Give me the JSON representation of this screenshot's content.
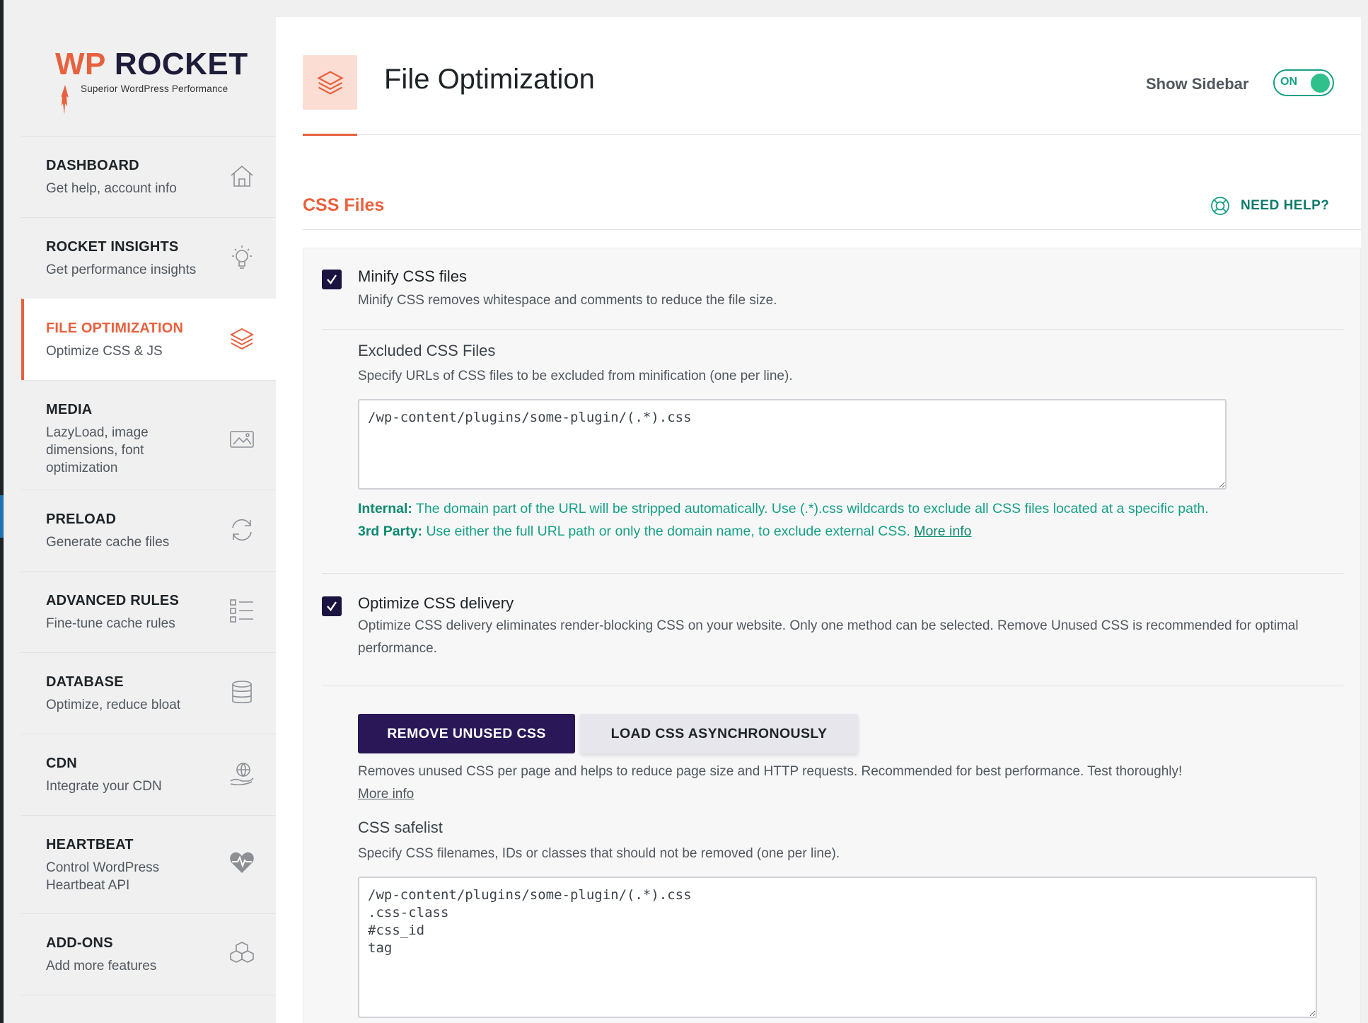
{
  "brand": {
    "logo_wp": "WP",
    "logo_rocket": " ROCKET",
    "tagline": "Superior WordPress Performance",
    "accent_color": "#e8613e",
    "dark_color": "#2a1758",
    "green_color": "#16a085"
  },
  "sidebar": {
    "items": [
      {
        "title": "DASHBOARD",
        "subtitle": "Get help, account info",
        "icon": "home-icon"
      },
      {
        "title": "ROCKET INSIGHTS",
        "subtitle": "Get performance insights",
        "icon": "lightbulb-icon"
      },
      {
        "title": "FILE OPTIMIZATION",
        "subtitle": "Optimize CSS & JS",
        "icon": "layers-icon",
        "active": true
      },
      {
        "title": "MEDIA",
        "subtitle": "LazyLoad, image dimensions, font optimization",
        "icon": "image-icon"
      },
      {
        "title": "PRELOAD",
        "subtitle": "Generate cache files",
        "icon": "refresh-icon"
      },
      {
        "title": "ADVANCED RULES",
        "subtitle": "Fine-tune cache rules",
        "icon": "list-icon"
      },
      {
        "title": "DATABASE",
        "subtitle": "Optimize, reduce bloat",
        "icon": "database-icon"
      },
      {
        "title": "CDN",
        "subtitle": "Integrate your CDN",
        "icon": "globe-hand-icon"
      },
      {
        "title": "HEARTBEAT",
        "subtitle": "Control WordPress Heartbeat API",
        "icon": "heart-pulse-icon"
      },
      {
        "title": "ADD-ONS",
        "subtitle": "Add more features",
        "icon": "cubes-icon"
      }
    ]
  },
  "header": {
    "title": "File Optimization",
    "show_sidebar_label": "Show Sidebar",
    "toggle_label": "ON"
  },
  "section": {
    "title": "CSS Files",
    "help_label": "NEED HELP?"
  },
  "minify": {
    "title": "Minify CSS files",
    "description": "Minify CSS removes whitespace and comments to reduce the file size.",
    "checked": true
  },
  "excluded": {
    "label": "Excluded CSS Files",
    "description": "Specify URLs of CSS files to be excluded from minification (one per line).",
    "value": "/wp-content/plugins/some-plugin/(.*).css",
    "internal_label": "Internal:",
    "internal_text": " The domain part of the URL will be stripped automatically. Use (.*).css wildcards to exclude all CSS files located at a specific path.",
    "third_label": "3rd Party:",
    "third_text": " Use either the full URL path or only the domain name, to exclude external CSS. ",
    "more_info": "More info"
  },
  "optimize_delivery": {
    "title": "Optimize CSS delivery",
    "description": "Optimize CSS delivery eliminates render-blocking CSS on your website. Only one method can be selected. Remove Unused CSS is recommended for optimal performance.",
    "checked": true
  },
  "methods": {
    "remove_unused": "REMOVE UNUSED CSS",
    "load_async": "LOAD CSS ASYNCHRONOUSLY",
    "selected": "REMOVE UNUSED CSS",
    "description": "Removes unused CSS per page and helps to reduce page size and HTTP requests. Recommended for best performance. Test thoroughly!",
    "more_info": "More info"
  },
  "safelist": {
    "label": "CSS safelist",
    "description": "Specify CSS filenames, IDs or classes that should not be removed (one per line).",
    "value": "/wp-content/plugins/some-plugin/(.*).css\n.css-class\n#css_id\ntag"
  }
}
